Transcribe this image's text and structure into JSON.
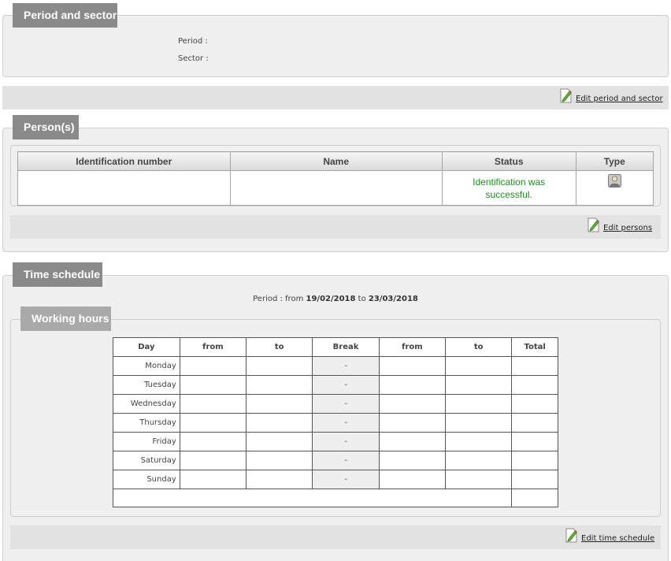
{
  "period_sector": {
    "title": "Period and sector",
    "period_label": "Period :",
    "sector_label": "Sector :",
    "edit_label": "Edit period and sector"
  },
  "persons": {
    "title": "Person(s)",
    "columns": [
      "Identification number",
      "Name",
      "Status",
      "Type"
    ],
    "rows": [
      {
        "id": "",
        "name": "",
        "status": "Identification was successful.",
        "type_icon": "person-icon"
      }
    ],
    "edit_label": "Edit persons"
  },
  "time_schedule": {
    "title": "Time schedule",
    "period_prefix": "Period : from",
    "period_from": "19/02/2018",
    "period_to_word": "to",
    "period_to": "23/03/2018",
    "working_hours": {
      "title": "Working hours",
      "columns": [
        "Day",
        "from",
        "to",
        "Break",
        "from",
        "to",
        "Total"
      ],
      "days": [
        {
          "day": "Monday",
          "break": "-"
        },
        {
          "day": "Tuesday",
          "break": "-"
        },
        {
          "day": "Wednesday",
          "break": "-"
        },
        {
          "day": "Thursday",
          "break": "-"
        },
        {
          "day": "Friday",
          "break": "-"
        },
        {
          "day": "Saturday",
          "break": "-"
        },
        {
          "day": "Sunday",
          "break": "-"
        }
      ]
    },
    "edit_label": "Edit time schedule"
  },
  "colors": {
    "tab_bg": "#8a8a8a",
    "tab_light_bg": "#a9a9a9",
    "panel_bg": "#efefef",
    "bar_bg": "#e3e2e2",
    "status_ok": "#1e8c1e"
  }
}
